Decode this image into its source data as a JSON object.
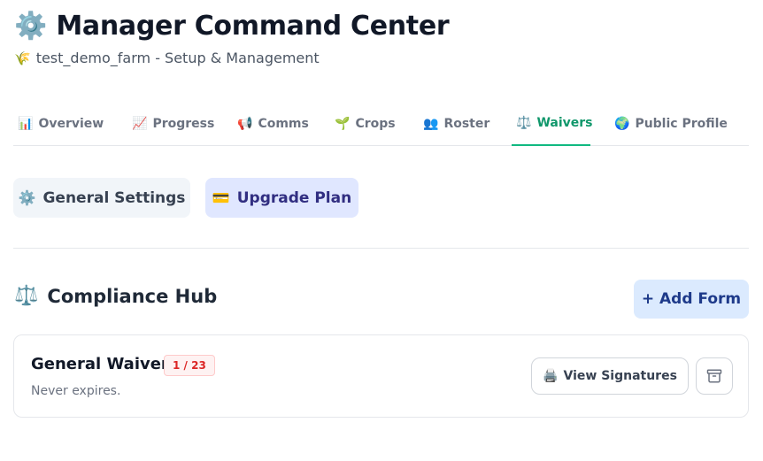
{
  "header": {
    "title_icon": "⚙️",
    "title": "Manager Command Center",
    "subtitle_icon": "🌾",
    "subtitle": "test_demo_farm - Setup & Management"
  },
  "tabs": [
    {
      "icon": "📊",
      "label": "Overview",
      "active": false
    },
    {
      "icon": "📈",
      "label": "Progress",
      "active": false
    },
    {
      "icon": "📢",
      "label": "Comms",
      "active": false
    },
    {
      "icon": "🌱",
      "label": "Crops",
      "active": false
    },
    {
      "icon": "👥",
      "label": "Roster",
      "active": false
    },
    {
      "icon": "⚖️",
      "label": "Waivers",
      "active": true
    },
    {
      "icon": "🌍",
      "label": "Public Profile",
      "active": false
    }
  ],
  "actions": {
    "settings_icon": "⚙️",
    "settings_label": "General Settings",
    "upgrade_icon": "💳",
    "upgrade_label": "Upgrade Plan"
  },
  "compliance": {
    "icon": "⚖️",
    "title": "Compliance Hub",
    "add_label": "+ Add Form",
    "waivers": [
      {
        "name": "General Waiver",
        "badge": "1 / 23",
        "expiry": "Never expires.",
        "view_icon": "🖨️",
        "view_label": "View Signatures",
        "archive_icon": "archive-icon"
      }
    ]
  },
  "colors": {
    "active_tab": "#10976b",
    "active_tab_underline": "#10b981",
    "upgrade_bg": "#e0e7ff",
    "add_bg": "#dbeafe",
    "badge_text": "#dc2626"
  }
}
